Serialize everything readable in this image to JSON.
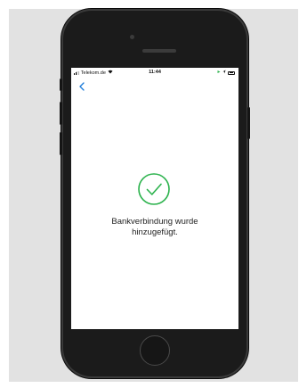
{
  "status_bar": {
    "carrier": "Telekom.de",
    "time": "11:44",
    "signal_icon": "signal-bars-icon",
    "wifi_icon": "wifi-icon",
    "charging_icon": "charging-icon",
    "location_icon": "location-arrow-icon",
    "battery_icon": "battery-icon"
  },
  "navigation": {
    "back_icon": "chevron-left-icon"
  },
  "content": {
    "success_icon": "checkmark-circle-icon",
    "message_line1": "Bankverbindung wurde",
    "message_line2": "hinzugefügt."
  },
  "colors": {
    "accent": "#2bb24c",
    "link": "#1a7ad9",
    "background_panel": "#e2e2e2",
    "phone_body": "#1b1b1b"
  }
}
